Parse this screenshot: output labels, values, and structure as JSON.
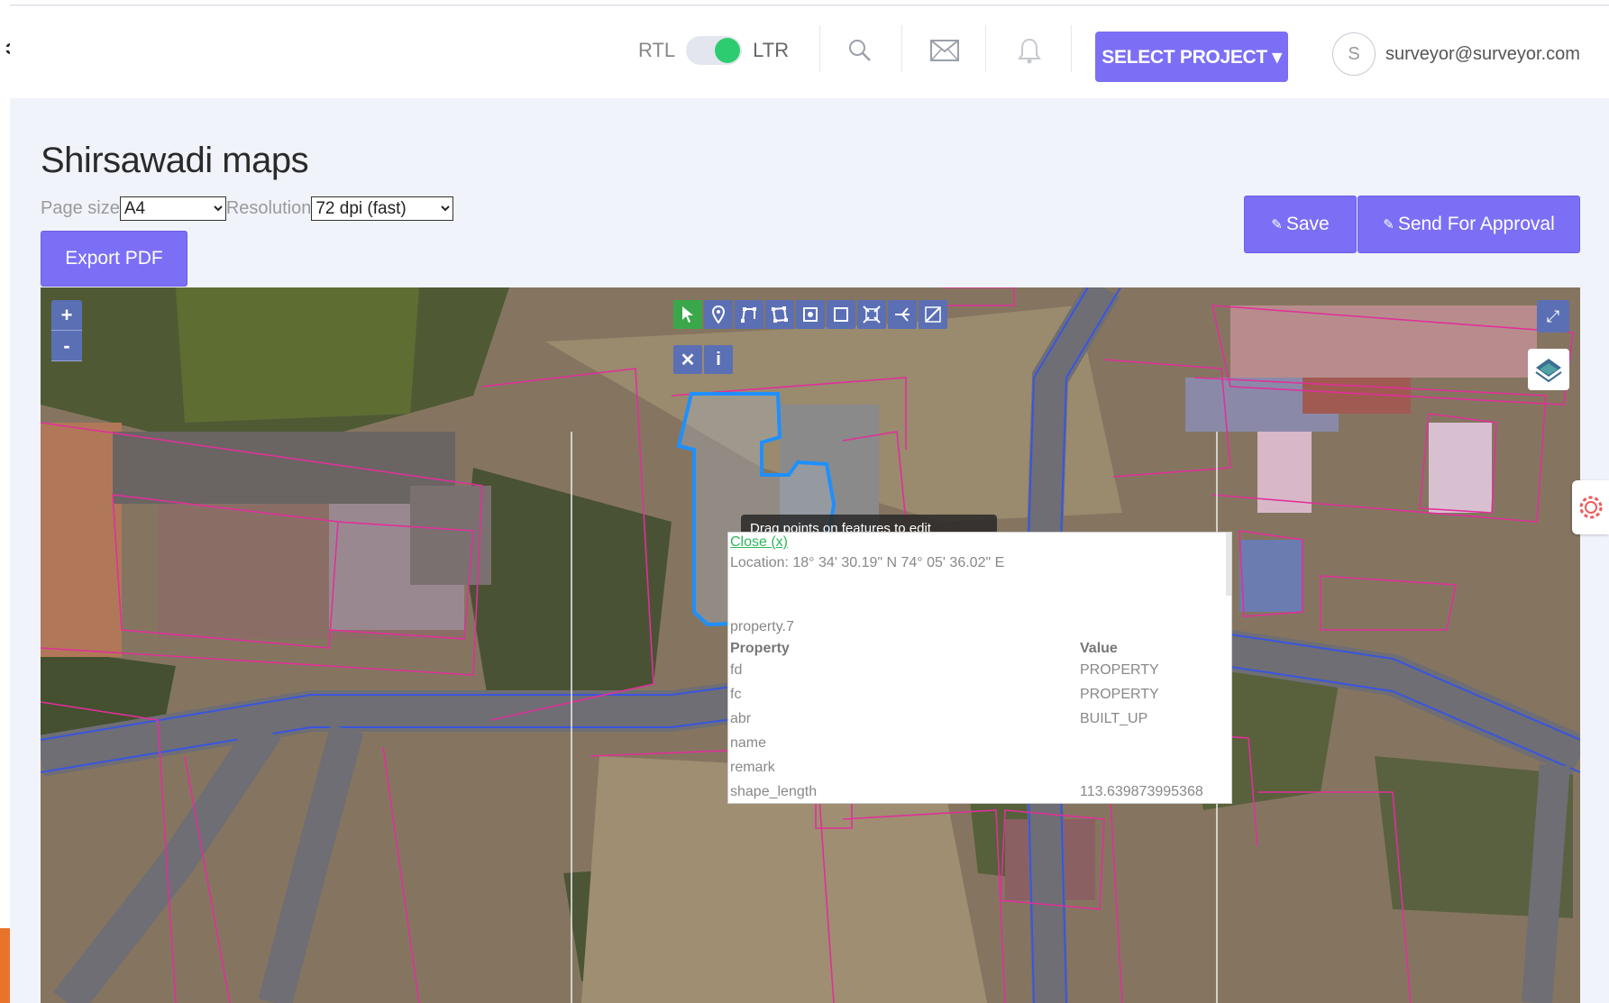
{
  "header": {
    "rtl_label": "RTL",
    "ltr_label": "LTR",
    "select_project_label": "SELECT PROJECT ▾",
    "avatar_initial": "S",
    "user_email": "surveyor@surveyor.com"
  },
  "page": {
    "title": "Shirsawadi maps",
    "page_size_label": "Page size",
    "page_size_value": "A4",
    "resolution_label": "Resolution",
    "resolution_value": "72 dpi (fast)",
    "export_label": "Export PDF",
    "save_label": "Save",
    "approval_label": "Send For Approval"
  },
  "map": {
    "zoom_in": "+",
    "zoom_out": "-",
    "tooltip": "Drag points on features to edit",
    "popup": {
      "close_label": "Close (x)",
      "location": "Location: 18° 34' 30.19\" N 74° 05' 36.02\" E",
      "feature_id": "property.7",
      "header_property": "Property",
      "header_value": "Value",
      "rows": [
        {
          "key": "fd",
          "value": "PROPERTY"
        },
        {
          "key": "fc",
          "value": "PROPERTY"
        },
        {
          "key": "abr",
          "value": "BUILT_UP"
        },
        {
          "key": "name",
          "value": ""
        },
        {
          "key": "remark",
          "value": ""
        },
        {
          "key": "shape_length",
          "value": "113.639873995368"
        }
      ]
    }
  },
  "colors": {
    "accent": "#7b6ff5",
    "toggle_on": "#2ecc71",
    "map_control": "#5b6fb5",
    "parcel_line": "#e0309a",
    "road_line": "#3a55e0",
    "selected_feature": "#1e90ff"
  }
}
